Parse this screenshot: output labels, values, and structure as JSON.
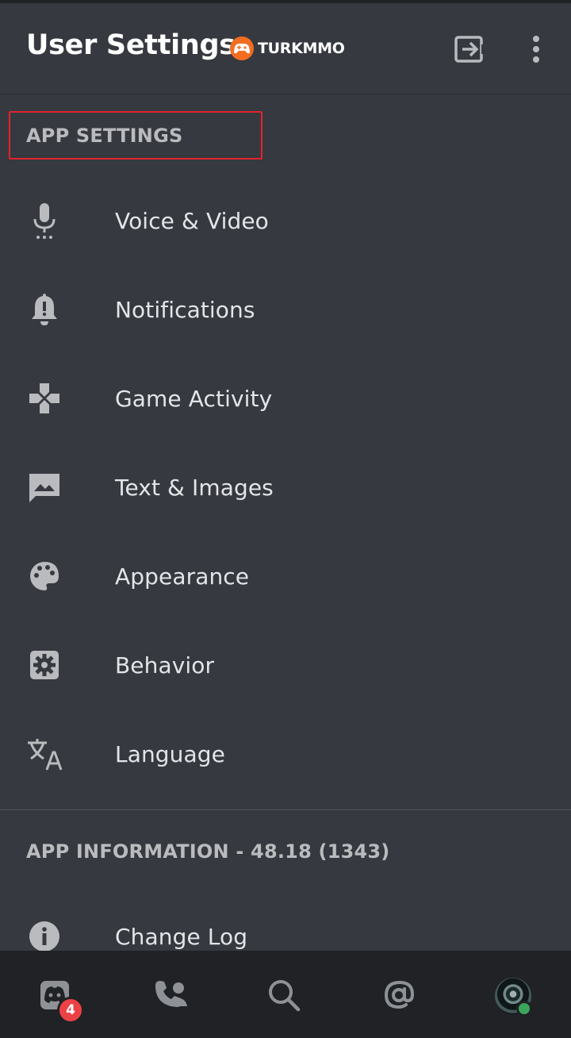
{
  "header": {
    "title": "User Settings",
    "brand": "TURKMMO"
  },
  "sections": [
    {
      "title": "APP SETTINGS",
      "items": [
        {
          "label": "Voice & Video",
          "icon": "microphone-icon"
        },
        {
          "label": "Notifications",
          "icon": "bell-icon"
        },
        {
          "label": "Game Activity",
          "icon": "gamepad-icon"
        },
        {
          "label": "Text & Images",
          "icon": "image-icon"
        },
        {
          "label": "Appearance",
          "icon": "palette-icon"
        },
        {
          "label": "Behavior",
          "icon": "gear-icon"
        },
        {
          "label": "Language",
          "icon": "translate-icon"
        }
      ]
    },
    {
      "title": "APP INFORMATION - 48.18 (1343)",
      "items": [
        {
          "label": "Change Log",
          "icon": "info-icon"
        }
      ]
    }
  ],
  "tabbar": {
    "tabs": [
      "home-icon",
      "friends-icon",
      "search-icon",
      "mentions-icon",
      "avatar"
    ],
    "home_badge": "4"
  },
  "colors": {
    "background": "#36393f",
    "tabbar": "#202225",
    "badge": "#ed4245",
    "status_online": "#3ba55d",
    "highlight": "#e3242b",
    "brand_orange": "#f36d21"
  }
}
